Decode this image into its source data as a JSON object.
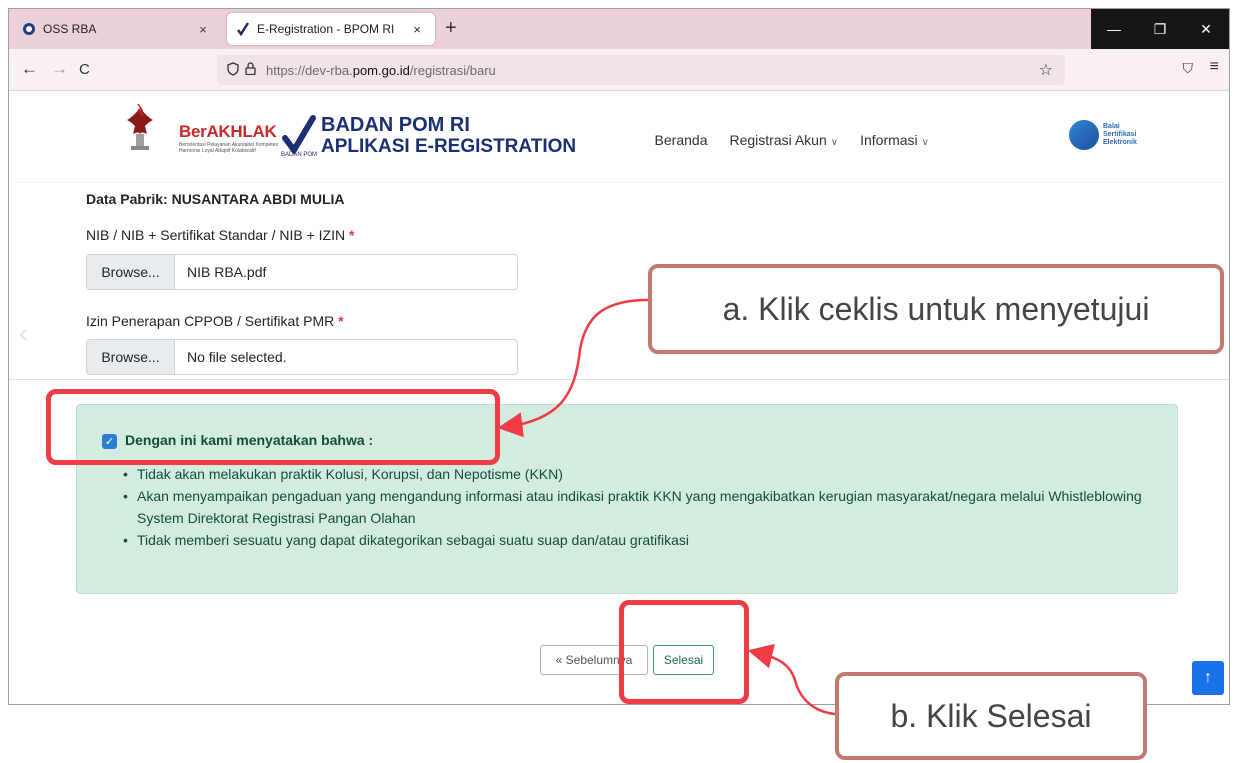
{
  "browser": {
    "tabs": [
      {
        "title": "OSS RBA",
        "close": "×"
      },
      {
        "title": "E-Registration - BPOM RI",
        "close": "×"
      }
    ],
    "new_tab": "+",
    "window_controls": {
      "minimize": "—",
      "restore": "❐",
      "close": "✕"
    },
    "nav": {
      "back": "←",
      "forward": "→",
      "reload": "C"
    },
    "url_prefix": "https://dev-rba.",
    "url_domain": "pom.go.id",
    "url_path": "/registrasi/baru",
    "bookmark": "☆",
    "pocket": "⛉",
    "menu": "≡"
  },
  "header": {
    "berakhlak": "BerAKHLAK",
    "berakhlak_tagline": "Berorientasi Pelayanan Akuntabel Kompeten Harmonis Loyal Adaptif Kolaboratif",
    "bpom_title_1": "BADAN ",
    "bpom_title_2": "POM RI",
    "bpom_app": "APLIKASI E-REGISTRATION",
    "bpom_small": "BADAN POM",
    "nav": {
      "home": "Beranda",
      "account": "Registrasi Akun",
      "info": "Informasi"
    },
    "bsre": [
      "Balai",
      "Sertifikasi",
      "Elektronik"
    ]
  },
  "form": {
    "factory_title": "Data Pabrik: NUSANTARA ABDI MULIA",
    "field1_label": "NIB / NIB + Sertifikat Standar / NIB + IZIN",
    "field1_browse": "Browse...",
    "field1_file": "NIB RBA.pdf",
    "field2_label": "Izin Penerapan CPPOB / Sertifikat PMR",
    "field2_browse": "Browse...",
    "field2_file": "No file selected.",
    "required_mark": "*"
  },
  "declaration": {
    "checked": true,
    "title": "Dengan ini kami menyatakan bahwa :",
    "items": [
      "Tidak akan melakukan praktik Kolusi, Korupsi, dan Nepotisme (KKN)",
      "Akan menyampaikan pengaduan yang mengandung informasi atau indikasi praktik KKN yang mengakibatkan kerugian masyarakat/negara melalui Whistleblowing System Direktorat Registrasi Pangan Olahan",
      "Tidak memberi sesuatu yang dapat dikategorikan sebagai suatu suap dan/atau gratifikasi"
    ]
  },
  "buttons": {
    "prev": "« Sebelumnya",
    "finish": "Selesai",
    "scroll_top": "↑"
  },
  "annotations": {
    "a": "a. Klik ceklis untuk menyetujui",
    "b": "b. Klik Selesai",
    "highlight_color": "#ee3b46",
    "callout_border": "#c27a6e"
  }
}
